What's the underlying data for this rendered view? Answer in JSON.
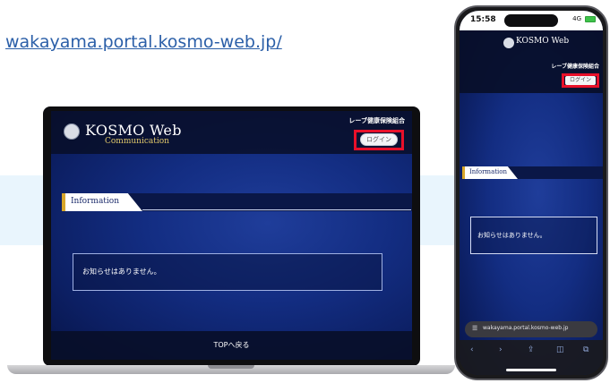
{
  "url_label": "wakayama.portal.kosmo-web.jp/",
  "laptop": {
    "logo_text": "KOSMO Web",
    "logo_sub": "Communication",
    "org_name": "レーブ健康保険組合",
    "login_label": "ログイン",
    "info_tab": "Information",
    "notice_text": "お知らせはありません。",
    "footer_text": "TOPへ戻る"
  },
  "phone": {
    "time": "15:58",
    "signal": "4G",
    "logo_text": "KOSMO Web",
    "org_name": "レーブ健康保険組合",
    "login_label": "ログイン",
    "info_tab": "Information",
    "notice_text": "お知らせはありません。",
    "url_text": "wakayama.portal.kosmo-web.jp",
    "toolbar": [
      "‹",
      "›",
      "⇪",
      "◫",
      "⧉"
    ]
  },
  "colors": {
    "accent_red": "#e8102a",
    "link_blue": "#2b5fa8",
    "brand_navy": "#0a1747",
    "gold": "#d7a62a"
  }
}
